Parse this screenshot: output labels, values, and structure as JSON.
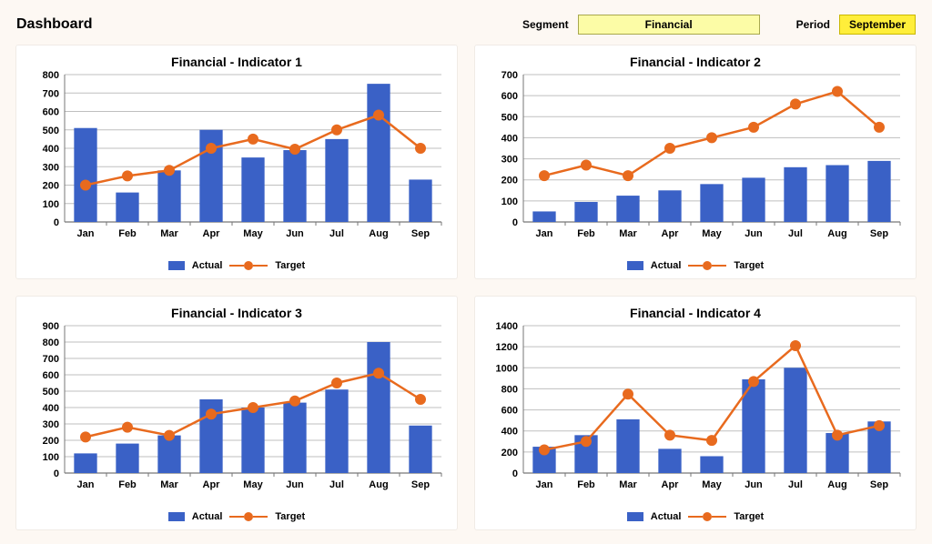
{
  "header": {
    "title": "Dashboard",
    "segment_label": "Segment",
    "segment_value": "Financial",
    "period_label": "Period",
    "period_value": "September"
  },
  "legend": {
    "actual": "Actual",
    "target": "Target"
  },
  "colors": {
    "bar": "#3a61c6",
    "line": "#e86a1e",
    "bg": "#fdf8f3"
  },
  "categories": [
    "Jan",
    "Feb",
    "Mar",
    "Apr",
    "May",
    "Jun",
    "Jul",
    "Aug",
    "Sep"
  ],
  "chart_data": [
    {
      "id": "chart1",
      "title": "Financial - Indicator 1",
      "type": "bar+line",
      "categories": [
        "Jan",
        "Feb",
        "Mar",
        "Apr",
        "May",
        "Jun",
        "Jul",
        "Aug",
        "Sep"
      ],
      "series": [
        {
          "name": "Actual",
          "type": "bar",
          "values": [
            510,
            160,
            280,
            500,
            350,
            390,
            450,
            750,
            230
          ]
        },
        {
          "name": "Target",
          "type": "line",
          "values": [
            200,
            250,
            280,
            400,
            450,
            395,
            500,
            580,
            400
          ]
        }
      ],
      "ylabel": "",
      "xlabel": "",
      "ylim": [
        0,
        800
      ],
      "ystep": 100
    },
    {
      "id": "chart2",
      "title": "Financial - Indicator 2",
      "type": "bar+line",
      "categories": [
        "Jan",
        "Feb",
        "Mar",
        "Apr",
        "May",
        "Jun",
        "Jul",
        "Aug",
        "Sep"
      ],
      "series": [
        {
          "name": "Actual",
          "type": "bar",
          "values": [
            50,
            95,
            125,
            150,
            180,
            210,
            260,
            270,
            290
          ]
        },
        {
          "name": "Target",
          "type": "line",
          "values": [
            220,
            270,
            220,
            350,
            400,
            450,
            560,
            620,
            450
          ]
        }
      ],
      "ylabel": "",
      "xlabel": "",
      "ylim": [
        0,
        700
      ],
      "ystep": 100
    },
    {
      "id": "chart3",
      "title": "Financial - Indicator 3",
      "type": "bar+line",
      "categories": [
        "Jan",
        "Feb",
        "Mar",
        "Apr",
        "May",
        "Jun",
        "Jul",
        "Aug",
        "Sep"
      ],
      "series": [
        {
          "name": "Actual",
          "type": "bar",
          "values": [
            120,
            180,
            230,
            450,
            400,
            430,
            510,
            800,
            290
          ]
        },
        {
          "name": "Target",
          "type": "line",
          "values": [
            220,
            280,
            230,
            360,
            400,
            440,
            550,
            610,
            450
          ]
        }
      ],
      "ylabel": "",
      "xlabel": "",
      "ylim": [
        0,
        900
      ],
      "ystep": 100
    },
    {
      "id": "chart4",
      "title": "Financial - Indicator 4",
      "type": "bar+line",
      "categories": [
        "Jan",
        "Feb",
        "Mar",
        "Apr",
        "May",
        "Jun",
        "Jul",
        "Aug",
        "Sep"
      ],
      "series": [
        {
          "name": "Actual",
          "type": "bar",
          "values": [
            250,
            360,
            510,
            230,
            160,
            890,
            1000,
            380,
            490
          ]
        },
        {
          "name": "Target",
          "type": "line",
          "values": [
            220,
            300,
            750,
            360,
            310,
            870,
            1210,
            360,
            450
          ]
        }
      ],
      "ylabel": "",
      "xlabel": "",
      "ylim": [
        0,
        1400
      ],
      "ystep": 200
    }
  ]
}
